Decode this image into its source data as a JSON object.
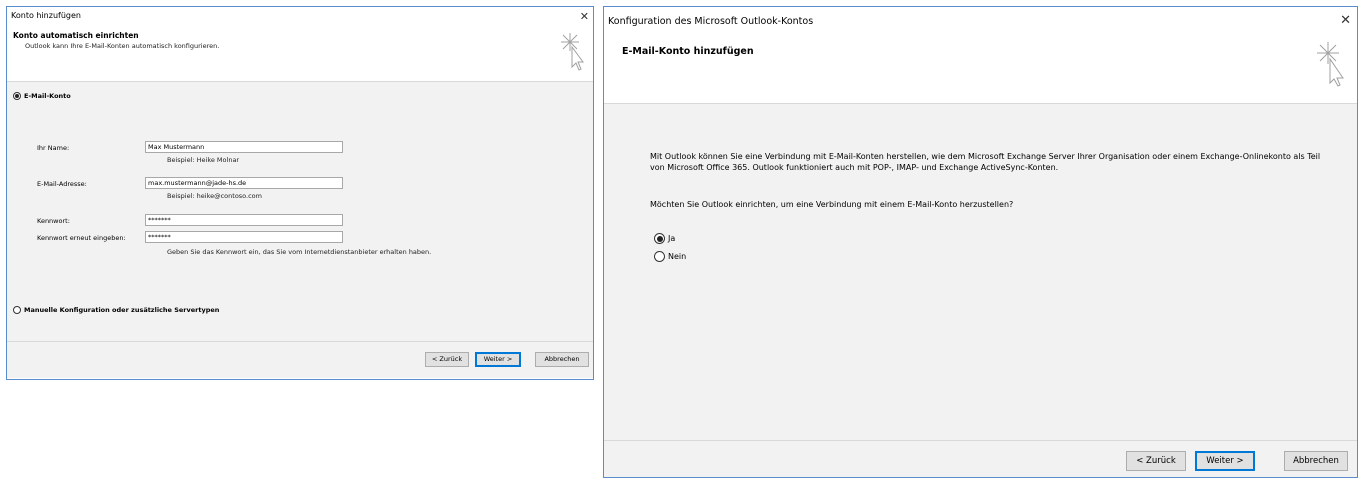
{
  "dialog1": {
    "title": "Konto hinzufügen",
    "close_glyph": "✕",
    "header_title": "Konto automatisch einrichten",
    "header_subtitle": "Outlook kann Ihre E-Mail-Konten automatisch konfigurieren.",
    "wizard_icon": "wizard-star-cursor-icon",
    "email_account_label": "E-Mail-Konto",
    "name_label": "Ihr Name:",
    "name_value": "Max Mustermann",
    "name_example": "Beispiel: Heike Molnar",
    "email_label": "E-Mail-Adresse:",
    "email_value": "max.mustermann@jade-hs.de",
    "email_example": "Beispiel: heike@contoso.com",
    "password_label": "Kennwort:",
    "password_value": "*******",
    "password_repeat_label": "Kennwort erneut eingeben:",
    "password_repeat_value": "*******",
    "password_hint": "Geben Sie das Kennwort ein, das Sie vom Internetdienstanbieter erhalten haben.",
    "manual_config_label": "Manuelle Konfiguration oder zusätzliche Servertypen",
    "back_button": "< Zurück",
    "next_button": "Weiter >",
    "cancel_button": "Abbrechen"
  },
  "dialog2": {
    "title": "Konfiguration des Microsoft Outlook-Kontos",
    "close_glyph": "✕",
    "header_title": "E-Mail-Konto hinzufügen",
    "wizard_icon": "wizard-star-cursor-icon",
    "description": "Mit Outlook können Sie eine Verbindung mit E-Mail-Konten herstellen, wie dem Microsoft Exchange Server Ihrer Organisation oder einem Exchange-Onlinekonto als Teil von Microsoft Office 365. Outlook funktioniert auch mit POP-, IMAP- und Exchange ActiveSync-Konten.",
    "question": "Möchten Sie Outlook einrichten, um eine Verbindung mit einem E-Mail-Konto herzustellen?",
    "option_yes": "Ja",
    "option_no": "Nein",
    "back_button": "< Zurück",
    "next_button": "Weiter >",
    "cancel_button": "Abbrechen"
  },
  "colors": {
    "window_border": "#5b8bd0",
    "panel_background": "#f2f2f2",
    "default_button_border": "#0078d7",
    "button_background": "#e1e1e1"
  }
}
